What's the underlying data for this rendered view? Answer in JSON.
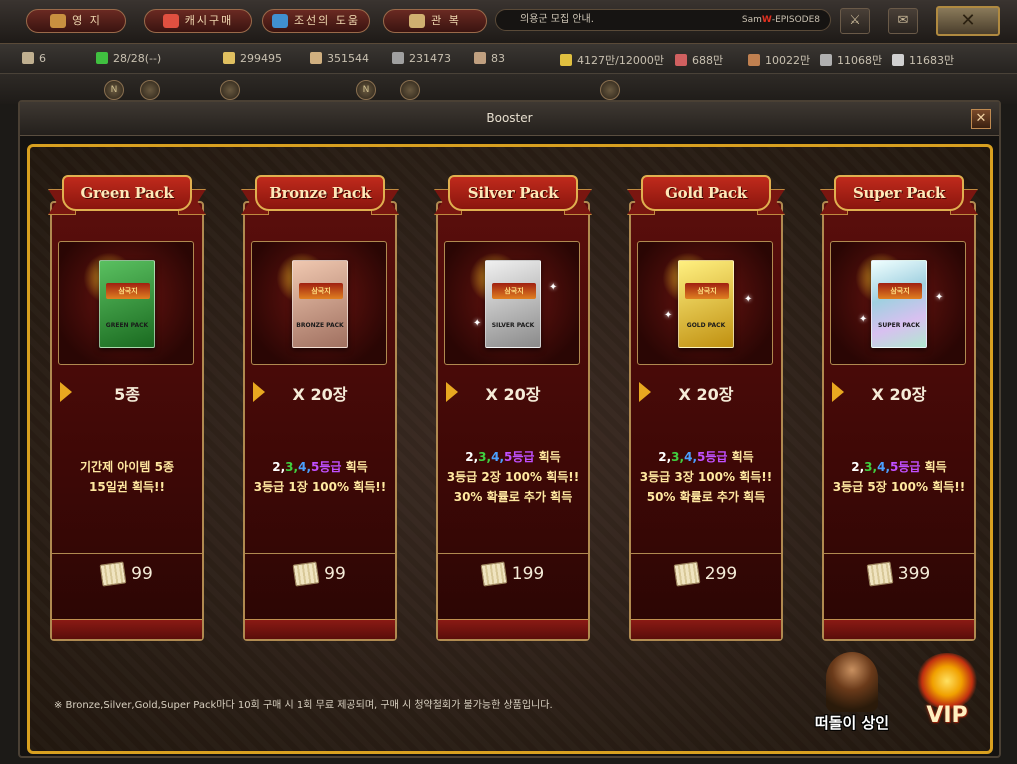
{
  "topbar": {
    "buttons": [
      {
        "label": "영 지"
      },
      {
        "label": "캐시구매"
      },
      {
        "label": "조선의 도움"
      },
      {
        "label": "관 복"
      }
    ],
    "notice_text": "의용군 모집 안내.",
    "episode_prefix": "Sam",
    "episode_highlight": "W",
    "episode_suffix": "-EPISODE8",
    "close_symbol": "✕"
  },
  "resources": [
    {
      "value": "6",
      "color": "#c0b090"
    },
    {
      "value": "28/28(--)",
      "color": "#40c040"
    },
    {
      "value": "299495",
      "color": "#e0c060"
    },
    {
      "value": "351544",
      "color": "#d0b080"
    },
    {
      "value": "231473",
      "color": "#a0a0a0"
    },
    {
      "value": "83",
      "color": "#c0a080"
    },
    {
      "value": "4127만/12000만",
      "color": "#e0c040"
    },
    {
      "value": "688만",
      "color": "#d06060"
    },
    {
      "value": "10022만",
      "color": "#c08050"
    },
    {
      "value": "11068만",
      "color": "#b0b0b0"
    },
    {
      "value": "11683만",
      "color": "#d0d0d0"
    }
  ],
  "dialog": {
    "title": "Booster",
    "close_symbol": "✕"
  },
  "packs": [
    {
      "name": "Green Pack",
      "pack_label": "GREEN PACK",
      "pack_color": "#2a8a30",
      "quantity": "5종",
      "desc_lines": [
        "기간제 아이템 5종",
        "15일권 획득!!"
      ],
      "price": "99"
    },
    {
      "name": "Bronze Pack",
      "pack_label": "BRONZE PACK",
      "pack_color": "#c89878",
      "quantity": "X 20장",
      "grade_prefix": "2,3,4,5등급",
      "grade_suffix": "획득",
      "desc_lines": [
        "3등급 1장 100% 획득!!"
      ],
      "price": "99"
    },
    {
      "name": "Silver Pack",
      "pack_label": "SILVER PACK",
      "pack_color": "#c8c8c8",
      "quantity": "X 20장",
      "grade_prefix": "2,3,4,5등급",
      "grade_suffix": "획득",
      "desc_lines": [
        "3등급 2장 100% 획득!!",
        "30% 확률로 추가 획득"
      ],
      "price": "199"
    },
    {
      "name": "Gold Pack",
      "pack_label": "GOLD PACK",
      "pack_color": "#e8c030",
      "quantity": "X 20장",
      "grade_prefix": "2,3,4,5등급",
      "grade_suffix": "획득",
      "desc_lines": [
        "3등급 3장 100% 획득!!",
        "50% 확률로 추가 획득"
      ],
      "price": "299"
    },
    {
      "name": "Super Pack",
      "pack_label": "SUPER PACK",
      "pack_color": "#c8e8f0",
      "quantity": "X 20장",
      "grade_prefix": "2,3,4,5등급",
      "grade_suffix": "획득",
      "desc_lines": [
        "3등급 5장 100% 획득!!"
      ],
      "price": "399"
    }
  ],
  "footer": {
    "note": "※ Bronze,Silver,Gold,Super Pack마다 10회 구매 시 1회 무료 제공되며, 구매 시 청약철회가 불가능한 상품입니다.",
    "merchant_label": "떠돌이 상인",
    "vip_label": "VIP"
  }
}
